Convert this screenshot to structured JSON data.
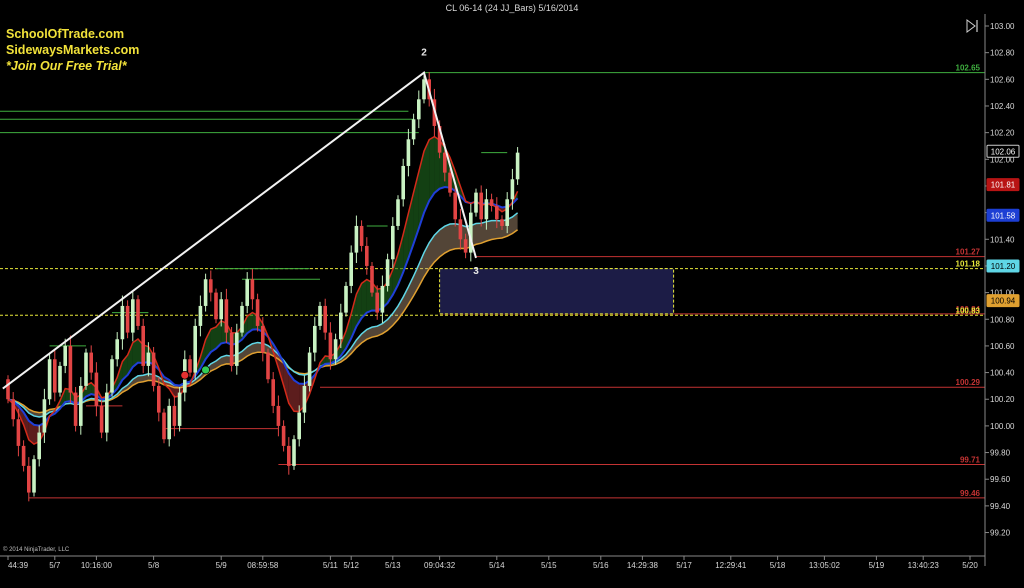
{
  "window_title": "CL 06-14 (24 JJ_Bars)  5/16/2014",
  "watermark": [
    "SchoolOfTrade.com",
    "SidewaysMarkets.com",
    "*Join Our Free Trial*"
  ],
  "copyright": "© 2014 NinjaTrader, LLC",
  "colors": {
    "background": "#000000",
    "up_candle": "#c9f2c3",
    "down_candle": "#e24444",
    "green_level": "#3fae3f",
    "red_level": "#c43333",
    "yellow_level": "#e8e83a",
    "ema_fast": "#d42a1a",
    "ema_slow": "#1f3fd8",
    "band_orange": "#e0a030",
    "band_cyan": "#5fd6e6",
    "zone_fill": "#1c1c46"
  },
  "chart_data": {
    "type": "candlestick",
    "instrument": "CL 06-14",
    "bar_type": "24 JJ_Bars",
    "y_range": [
      99.2,
      103.1
    ],
    "y_ticks": [
      "103.00",
      "102.80",
      "102.60",
      "102.40",
      "102.20",
      "102.00",
      "101.80",
      "101.60",
      "101.40",
      "101.20",
      "101.00",
      "100.80",
      "100.60",
      "100.40",
      "100.20",
      "100.00",
      "99.80",
      "99.60",
      "99.40",
      "99.20"
    ],
    "x_tick_labels": [
      {
        "label": "44:39",
        "bar": 0
      },
      {
        "label": "5/7",
        "bar": 9
      },
      {
        "label": "10:16:00",
        "bar": 17
      },
      {
        "label": "5/8",
        "bar": 28
      },
      {
        "label": "5/9",
        "bar": 41
      },
      {
        "label": "08:59:58",
        "bar": 49
      },
      {
        "label": "5/11",
        "bar": 62
      },
      {
        "label": "5/12",
        "bar": 66
      },
      {
        "label": "5/13",
        "bar": 74
      },
      {
        "label": "09:04:32",
        "bar": 83
      },
      {
        "label": "5/14",
        "bar": 94
      },
      {
        "label": "5/15",
        "bar": 104
      },
      {
        "label": "5/16",
        "bar": 114
      },
      {
        "label": "14:29:38",
        "bar": 122
      },
      {
        "label": "5/17",
        "bar": 130
      },
      {
        "label": "12:29:41",
        "bar": 139
      },
      {
        "label": "5/18",
        "bar": 148
      },
      {
        "label": "13:05:02",
        "bar": 157
      },
      {
        "label": "5/19",
        "bar": 167
      },
      {
        "label": "13:40:23",
        "bar": 176
      },
      {
        "label": "5/20",
        "bar": 185
      }
    ],
    "closes": [
      100.2,
      100.05,
      99.85,
      99.7,
      99.5,
      99.75,
      99.95,
      100.2,
      100.5,
      100.25,
      100.45,
      100.6,
      100.25,
      100.0,
      100.3,
      100.55,
      100.4,
      100.15,
      99.95,
      100.25,
      100.5,
      100.65,
      100.9,
      100.7,
      100.95,
      100.75,
      100.45,
      100.55,
      100.3,
      100.1,
      99.9,
      100.15,
      100.0,
      100.25,
      100.5,
      100.4,
      100.75,
      100.9,
      101.1,
      101.0,
      100.8,
      100.95,
      100.7,
      100.45,
      100.7,
      100.9,
      101.1,
      100.95,
      100.75,
      100.55,
      100.35,
      100.15,
      100.0,
      99.85,
      99.7,
      99.9,
      100.1,
      100.3,
      100.55,
      100.75,
      100.9,
      100.7,
      100.5,
      100.65,
      100.85,
      101.05,
      101.3,
      101.5,
      101.35,
      101.2,
      101.0,
      100.85,
      101.05,
      101.25,
      101.5,
      101.7,
      101.95,
      102.15,
      102.3,
      102.45,
      102.6,
      102.45,
      102.25,
      102.05,
      101.9,
      101.75,
      101.55,
      101.4,
      101.3,
      101.6,
      101.75,
      101.55,
      101.7,
      101.65,
      101.55,
      101.5,
      101.7,
      101.85,
      102.05
    ],
    "initial_open": 100.35,
    "overlays": [
      "EMA fast (red)",
      "EMA slow (blue)",
      "Cloud band (orange/cyan)"
    ],
    "markers": [
      {
        "type": "dot",
        "color": "#e53030",
        "bar": 34,
        "price": 100.38
      },
      {
        "type": "dot",
        "color": "#33cc55",
        "bar": 38,
        "price": 100.42
      }
    ],
    "wave_labels": [
      {
        "label": "2",
        "bar": 80,
        "price": 102.78
      },
      {
        "label": "3",
        "bar": 90,
        "price": 101.14
      }
    ],
    "trendline": [
      {
        "bar": -1,
        "price": 100.28
      },
      {
        "bar": 80,
        "price": 102.65
      },
      {
        "bar": 90,
        "price": 101.26
      }
    ],
    "levels": [
      {
        "price": 102.65,
        "label": "102.65",
        "color": "green",
        "start_bar": 80
      },
      {
        "price": 101.27,
        "label": "101.27",
        "color": "red",
        "start_bar": 90
      },
      {
        "price": 101.18,
        "label": "101.18",
        "color": "yellow",
        "start_bar": -3,
        "dashed": true
      },
      {
        "price": 100.84,
        "label": "100.84",
        "color": "red",
        "start_bar": 83
      },
      {
        "price": 100.83,
        "label": "100.83",
        "color": "yellow",
        "start_bar": -3,
        "dashed": true
      },
      {
        "price": 100.29,
        "label": "100.29",
        "color": "red",
        "start_bar": 60
      },
      {
        "price": 99.71,
        "label": "99.71",
        "color": "red",
        "start_bar": 52
      },
      {
        "price": 99.46,
        "label": "99.46",
        "color": "red",
        "start_bar": 4
      }
    ],
    "short_levels": [
      {
        "price": 102.36,
        "from_bar": -3,
        "to_bar": 77
      },
      {
        "price": 102.3,
        "from_bar": -3,
        "to_bar": 78
      },
      {
        "price": 102.2,
        "from_bar": -3,
        "to_bar": 79
      },
      {
        "price": 102.05,
        "from_bar": 91,
        "to_bar": 96
      },
      {
        "price": 101.5,
        "from_bar": 69,
        "to_bar": 73
      },
      {
        "price": 101.18,
        "from_bar": 40,
        "to_bar": 58
      },
      {
        "price": 101.1,
        "from_bar": 45,
        "to_bar": 60
      },
      {
        "price": 100.85,
        "from_bar": 20,
        "to_bar": 27
      },
      {
        "price": 100.6,
        "from_bar": 8,
        "to_bar": 15
      },
      {
        "price": 100.15,
        "from_bar": 15,
        "to_bar": 22
      },
      {
        "price": 99.98,
        "from_bar": 30,
        "to_bar": 52
      }
    ],
    "zone": {
      "from_bar": 83,
      "to_bar": 128,
      "top": 101.18,
      "bottom": 100.84,
      "dashed_border": "yellow"
    },
    "price_badges": [
      {
        "value": "102.06",
        "price": 102.06,
        "bg": "#000000",
        "fg": "#ffffff",
        "border": "#cccccc"
      },
      {
        "value": "101.81",
        "price": 101.81,
        "bg": "#b81414",
        "fg": "#ffffff",
        "border": "#b81414"
      },
      {
        "value": "101.58",
        "price": 101.58,
        "bg": "#1d3fd4",
        "fg": "#ffffff",
        "border": "#1d3fd4"
      },
      {
        "value": "101.20",
        "price": 101.2,
        "bg": "#5fd6e6",
        "fg": "#000000",
        "border": "#5fd6e6"
      },
      {
        "value": "100.94",
        "price": 100.94,
        "bg": "#e0a030",
        "fg": "#000000",
        "border": "#e0a030"
      }
    ]
  }
}
